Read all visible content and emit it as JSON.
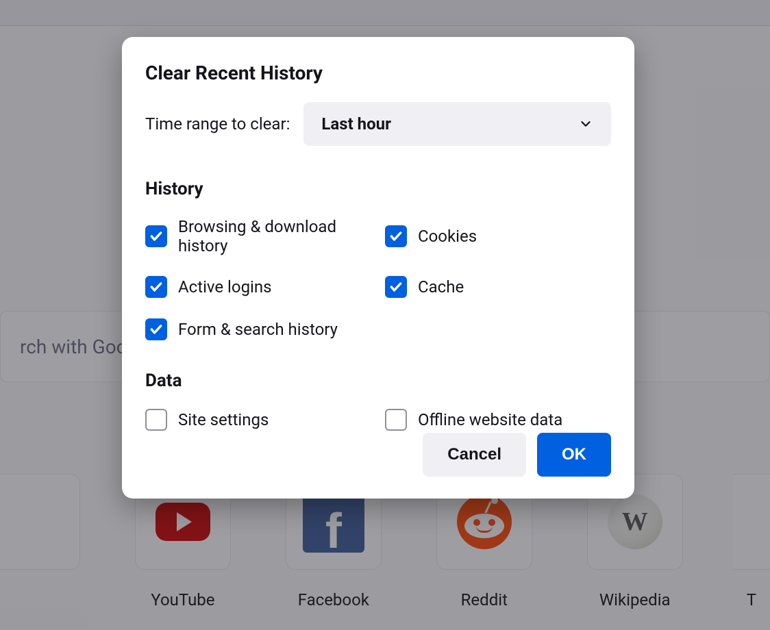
{
  "background": {
    "search_placeholder": "rch with Goog",
    "tiles": [
      {
        "label": "",
        "icon": "blank"
      },
      {
        "label": "YouTube",
        "icon": "youtube"
      },
      {
        "label": "Facebook",
        "icon": "facebook"
      },
      {
        "label": "Reddit",
        "icon": "reddit"
      },
      {
        "label": "Wikipedia",
        "icon": "wikipedia"
      },
      {
        "label": "T",
        "icon": "partial"
      }
    ]
  },
  "dialog": {
    "title": "Clear Recent History",
    "time_range_label": "Time range to clear:",
    "time_range_value": "Last hour",
    "sections": {
      "history": {
        "title": "History",
        "items": [
          {
            "label": "Browsing & download history",
            "checked": true
          },
          {
            "label": "Cookies",
            "checked": true
          },
          {
            "label": "Active logins",
            "checked": true
          },
          {
            "label": "Cache",
            "checked": true
          },
          {
            "label": "Form & search history",
            "checked": true
          }
        ]
      },
      "data": {
        "title": "Data",
        "items": [
          {
            "label": "Site settings",
            "checked": false
          },
          {
            "label": "Offline website data",
            "checked": false
          }
        ]
      }
    },
    "buttons": {
      "cancel": "Cancel",
      "ok": "OK"
    }
  }
}
